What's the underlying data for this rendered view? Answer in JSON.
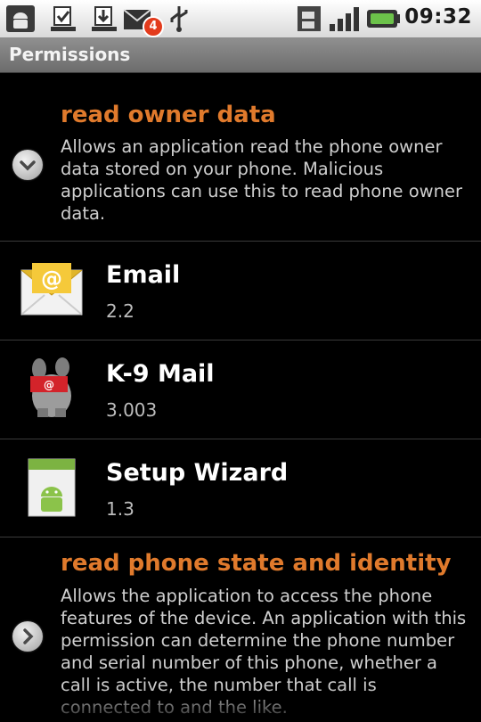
{
  "status_bar": {
    "time": "09:32",
    "notification_badge": "4",
    "icons": [
      "android-icon",
      "download-icon",
      "download-icon",
      "mail-icon",
      "usb-icon",
      "sim-icon",
      "signal-icon",
      "battery-icon"
    ]
  },
  "title_bar": {
    "title": "Permissions"
  },
  "permissions": [
    {
      "title": "read owner data",
      "description": "Allows an application read the phone owner data stored on your phone. Malicious applications can use this to read phone owner data.",
      "apps": [
        {
          "name": "Email",
          "version": "2.2",
          "icon": "email-icon"
        },
        {
          "name": "K-9 Mail",
          "version": "3.003",
          "icon": "k9-mail-icon"
        },
        {
          "name": "Setup Wizard",
          "version": "1.3",
          "icon": "setup-wizard-icon"
        }
      ]
    },
    {
      "title": "read phone state and identity",
      "description": "Allows the application to access the phone features of the device. An application with this permission can determine the phone number and serial number of this phone, whether a call is active, the number that call is connected to and the like."
    }
  ],
  "colors": {
    "accent": "#e07a2c",
    "background": "#000000"
  }
}
